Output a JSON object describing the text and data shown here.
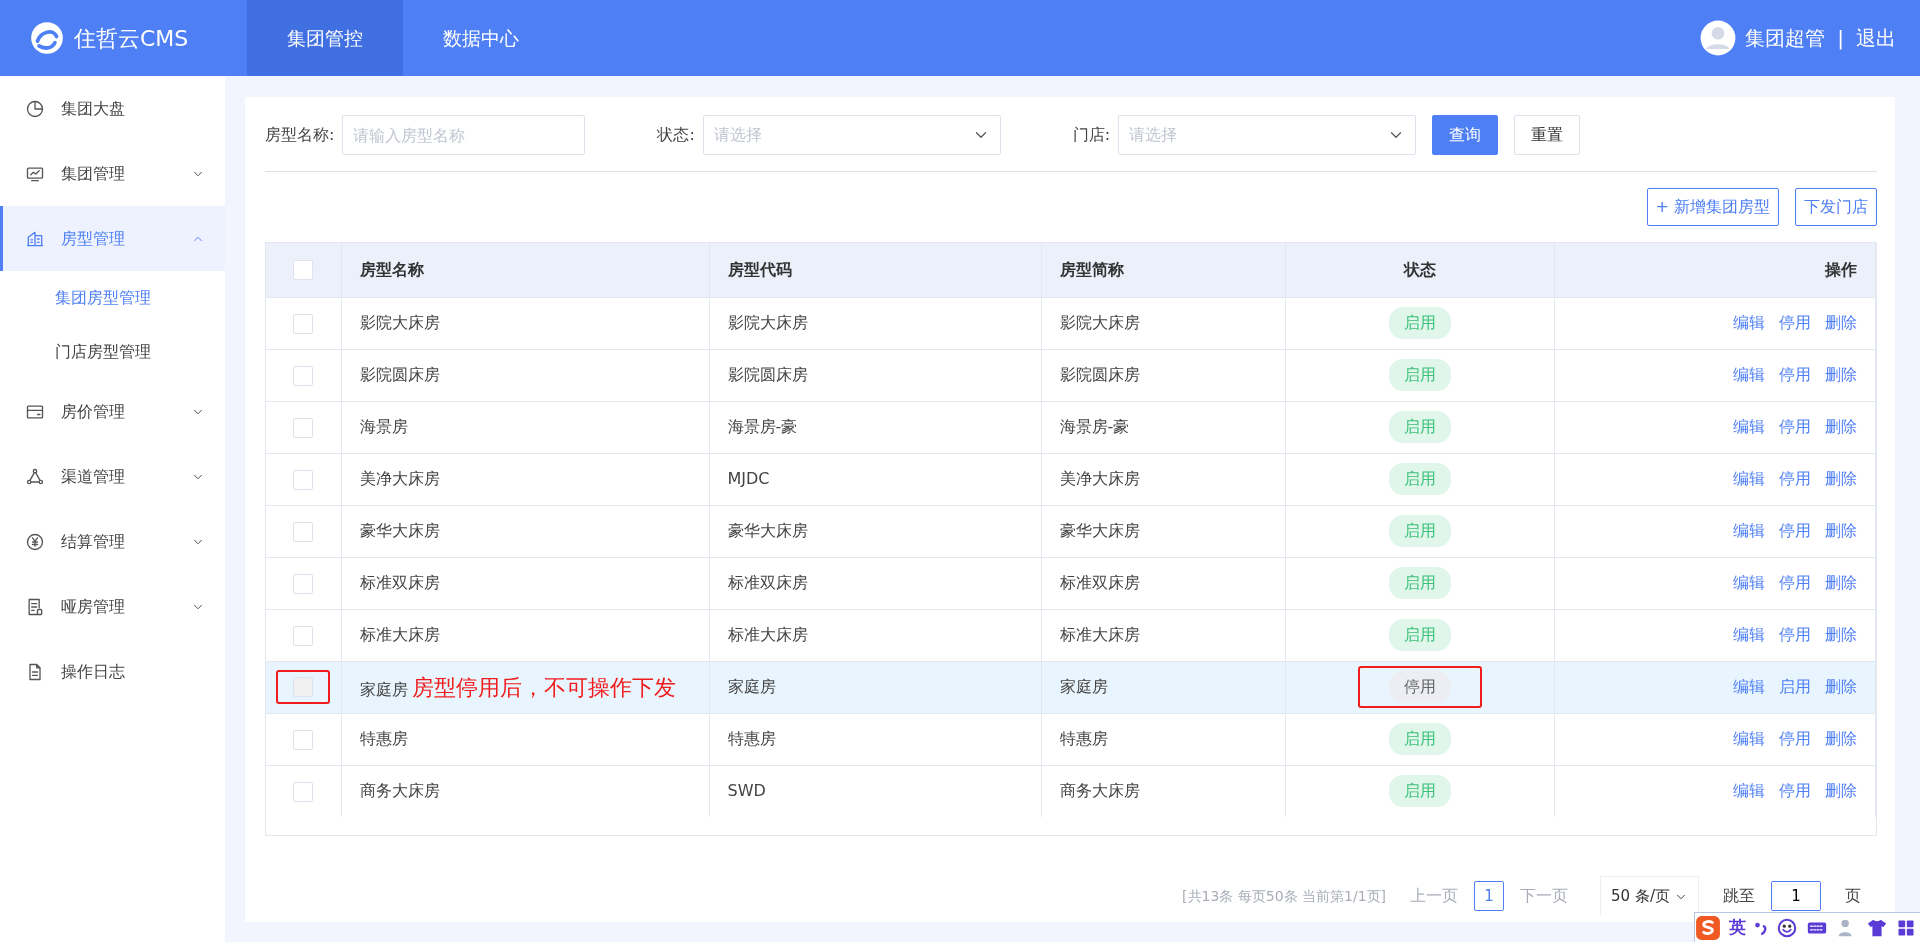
{
  "topbar": {
    "brand": "住哲云CMS",
    "tabs": [
      {
        "label": "集团管控",
        "selected": true
      },
      {
        "label": "数据中心",
        "selected": false
      }
    ],
    "user": "集团超管",
    "separator": "|",
    "logout": "退出"
  },
  "sidebar": {
    "items": [
      {
        "label": "集团大盘",
        "kind": "link",
        "selected": false
      },
      {
        "label": "集团管理",
        "kind": "group",
        "expanded": false,
        "selected": false
      },
      {
        "label": "房型管理",
        "kind": "group",
        "expanded": true,
        "selected": true,
        "children": [
          {
            "label": "集团房型管理",
            "selected": true
          },
          {
            "label": "门店房型管理",
            "selected": false
          }
        ]
      },
      {
        "label": "房价管理",
        "kind": "group",
        "expanded": false,
        "selected": false
      },
      {
        "label": "渠道管理",
        "kind": "group",
        "expanded": false,
        "selected": false
      },
      {
        "label": "结算管理",
        "kind": "group",
        "expanded": false,
        "selected": false
      },
      {
        "label": "哑房管理",
        "kind": "group",
        "expanded": false,
        "selected": false
      },
      {
        "label": "操作日志",
        "kind": "link",
        "selected": false
      }
    ]
  },
  "filters": [
    {
      "label": "房型名称:",
      "kind": "input",
      "placeholder": "请输入房型名称"
    },
    {
      "label": "状态:",
      "kind": "select",
      "placeholder": "请选择"
    },
    {
      "label": "门店:",
      "kind": "select",
      "placeholder": "请选择"
    }
  ],
  "filter_buttons": [
    {
      "label": "查询",
      "kind": "primary"
    },
    {
      "label": "重置",
      "kind": "plain"
    }
  ],
  "toolbar_buttons": [
    "+ 新增集团房型",
    "下发门店"
  ],
  "table": {
    "columns": [
      "房型名称",
      "房型代码",
      "房型简称",
      "状态",
      "操作"
    ],
    "header_checked": false,
    "rows": [
      {
        "name": "影院大床房",
        "code": "影院大床房",
        "abbr": "影院大床房",
        "status": {
          "label": "启用",
          "kind": "enabled"
        },
        "actions": [
          "编辑",
          "停用",
          "删除"
        ],
        "checked": false,
        "disabled": false,
        "highlighted": false
      },
      {
        "name": "影院圆床房",
        "code": "影院圆床房",
        "abbr": "影院圆床房",
        "status": {
          "label": "启用",
          "kind": "enabled"
        },
        "actions": [
          "编辑",
          "停用",
          "删除"
        ],
        "checked": false,
        "disabled": false,
        "highlighted": false
      },
      {
        "name": "海景房",
        "code": "海景房-豪",
        "abbr": "海景房-豪",
        "status": {
          "label": "启用",
          "kind": "enabled"
        },
        "actions": [
          "编辑",
          "停用",
          "删除"
        ],
        "checked": false,
        "disabled": false,
        "highlighted": false
      },
      {
        "name": "美净大床房",
        "code": "MJDC",
        "abbr": "美净大床房",
        "status": {
          "label": "启用",
          "kind": "enabled"
        },
        "actions": [
          "编辑",
          "停用",
          "删除"
        ],
        "checked": false,
        "disabled": false,
        "highlighted": false
      },
      {
        "name": "豪华大床房",
        "code": "豪华大床房",
        "abbr": "豪华大床房",
        "status": {
          "label": "启用",
          "kind": "enabled"
        },
        "actions": [
          "编辑",
          "停用",
          "删除"
        ],
        "checked": false,
        "disabled": false,
        "highlighted": false
      },
      {
        "name": "标准双床房",
        "code": "标准双床房",
        "abbr": "标准双床房",
        "status": {
          "label": "启用",
          "kind": "enabled"
        },
        "actions": [
          "编辑",
          "停用",
          "删除"
        ],
        "checked": false,
        "disabled": false,
        "highlighted": false
      },
      {
        "name": "标准大床房",
        "code": "标准大床房",
        "abbr": "标准大床房",
        "status": {
          "label": "启用",
          "kind": "enabled"
        },
        "actions": [
          "编辑",
          "停用",
          "删除"
        ],
        "checked": false,
        "disabled": false,
        "highlighted": false
      },
      {
        "name": "家庭房",
        "code": "家庭房",
        "abbr": "家庭房",
        "status": {
          "label": "停用",
          "kind": "disabled"
        },
        "actions": [
          "编辑",
          "启用",
          "删除"
        ],
        "checked": false,
        "disabled": true,
        "highlighted": true,
        "annotation": "房型停用后，不可操作下发"
      },
      {
        "name": "特惠房",
        "code": "特惠房",
        "abbr": "特惠房",
        "status": {
          "label": "启用",
          "kind": "enabled"
        },
        "actions": [
          "编辑",
          "停用",
          "删除"
        ],
        "checked": false,
        "disabled": false,
        "highlighted": false
      },
      {
        "name": "商务大床房",
        "code": "SWD",
        "abbr": "商务大床房",
        "status": {
          "label": "启用",
          "kind": "enabled"
        },
        "actions": [
          "编辑",
          "停用",
          "删除"
        ],
        "checked": false,
        "disabled": false,
        "highlighted": false
      }
    ]
  },
  "pagination": {
    "summary": "[共13条 每页50条 当前第1/1页]",
    "prev": "上一页",
    "pages": [
      {
        "label": "1",
        "selected": true
      }
    ],
    "next": "下一页",
    "page_size": "50 条/页",
    "jump_label": "跳至",
    "jump_value": "1",
    "jump_suffix": "页"
  },
  "ime_toolbar": {
    "language": "英"
  }
}
